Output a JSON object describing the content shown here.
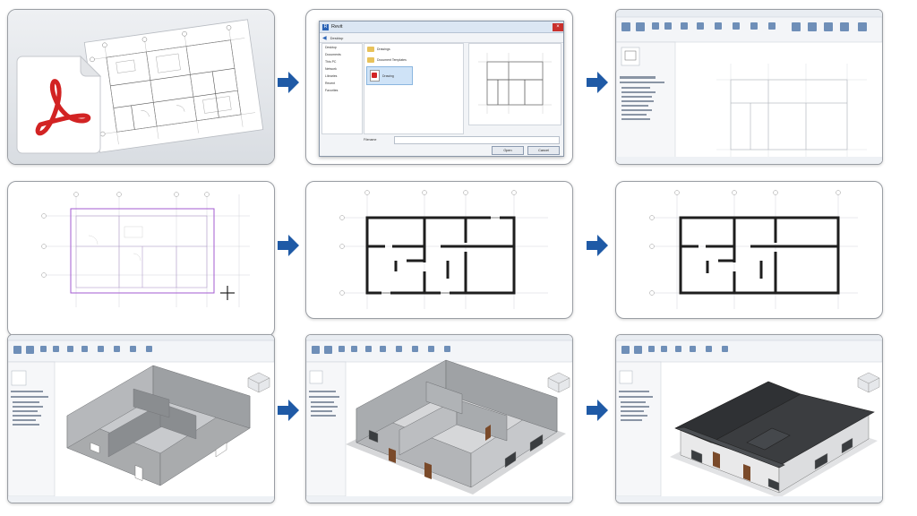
{
  "dialog": {
    "title": "Revit",
    "folder_label": "Desktop",
    "tree_items": [
      "Desktop",
      "Documents",
      "This PC",
      "Network",
      "Libraries",
      "Recent",
      "Favorites"
    ],
    "files": [
      "Drawings",
      "Document Templates",
      "Drawing"
    ],
    "filename_label": "Filename",
    "open_button": "Open",
    "cancel_button": "Cancel"
  },
  "colors": {
    "arrow": "#1f5aa6",
    "acrobat_red": "#d22323",
    "wall_gray": "#a9abad",
    "roof_dark": "#3b3d40",
    "door_brown": "#7a4a2a",
    "selection_purple": "#a35bd1"
  }
}
